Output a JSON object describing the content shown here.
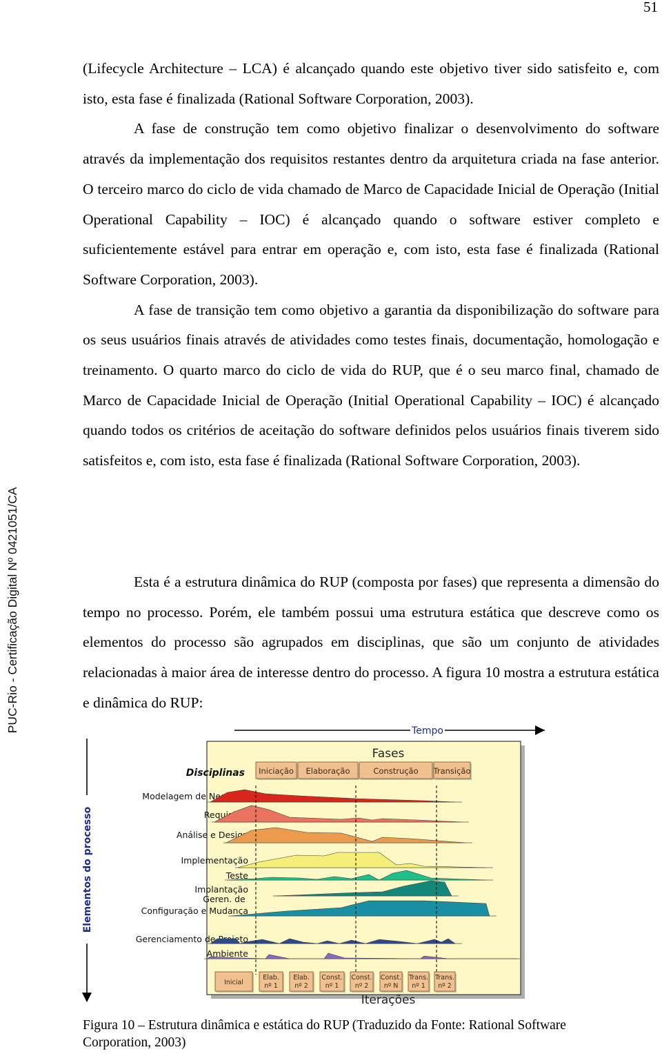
{
  "page": {
    "number": "51",
    "side_stamp": "PUC-Rio - Certificação Digital Nº 0421051/CA"
  },
  "paragraphs": [
    "(Lifecycle Architecture – LCA) é alcançado quando este objetivo tiver sido satisfeito e, com isto, esta fase é finalizada (Rational Software Corporation, 2003).",
    "A fase de construção tem como objetivo finalizar o desenvolvimento do software através da implementação dos requisitos restantes dentro da arquitetura criada na fase anterior. O terceiro marco do ciclo de vida chamado de Marco de Capacidade Inicial de Operação (Initial Operational Capability – IOC) é alcançado quando o software estiver completo e suficientemente estável para entrar em operação e, com isto, esta fase é finalizada (Rational Software Corporation, 2003).",
    "A fase de transição tem como objetivo a garantia da disponibilização do software para os seus usuários finais através de atividades como testes finais, documentação, homologação e treinamento. O quarto marco do ciclo de vida do RUP, que é o seu marco final, chamado de Marco de Capacidade Inicial de Operação (Initial Operational Capability – IOC) é alcançado quando todos os critérios de aceitação do software definidos pelos usuários finais tiverem sido satisfeitos e, com isto, esta fase é finalizada (Rational Software Corporation, 2003).",
    "Esta é a estrutura dinâmica do RUP (composta por fases) que representa a dimensão do tempo no processo. Porém, ele também possui uma estrutura estática que descreve como os elementos do processo são agrupados em disciplinas, que são um conjunto de atividades relacionadas à maior área de interesse dentro do processo. A figura 10 mostra a estrutura estática e dinâmica do RUP:"
  ],
  "figure": {
    "time_label": "Tempo",
    "process_axis_label": "Elementos do processo",
    "phases_title": "Fases",
    "disciplines_title": "Disciplinas",
    "iterations_title": "Iterações",
    "phases": [
      "Iniciação",
      "Elaboração",
      "Construção",
      "Transição"
    ],
    "disciplines": [
      {
        "label": "Modelagem de Negócios",
        "color": "#d9261c"
      },
      {
        "label": "Requisitos",
        "color": "#e8735f"
      },
      {
        "label": "Análise e Design",
        "color": "#ec9a4c"
      },
      {
        "label": "Implementação",
        "color": "#f5ef7a"
      },
      {
        "label": "Teste",
        "color": "#1fbf8a"
      },
      {
        "label": "Implantação",
        "color": "#13877a"
      },
      {
        "label": "Geren. de Configuração e Mudança",
        "label_lines": [
          "Geren. de",
          "Configuração e Mudança"
        ],
        "color": "#1a8ea2"
      },
      {
        "label": "Gerenciamento de Projeto",
        "color": "#2c4a8c"
      },
      {
        "label": "Ambiente",
        "color": "#8a6bc0"
      }
    ],
    "iterations": [
      [
        "Inicial"
      ],
      [
        "Elab.",
        "nº 1"
      ],
      [
        "Elab.",
        "nº 2"
      ],
      [
        "Const.",
        "nº 1"
      ],
      [
        "Const.",
        "nº 2"
      ],
      [
        "Const.",
        "nº N"
      ],
      [
        "Trans.",
        "nº 1"
      ],
      [
        "Trans.",
        "nº 2"
      ]
    ],
    "colors": {
      "panel_bg": "#fdf8c6",
      "box_fill": "#f0c08e",
      "title_text": "#1d2d8c"
    }
  },
  "caption": "Figura 10 – Estrutura dinâmica e estática do RUP  (Traduzido da Fonte: Rational Software Corporation, 2003)"
}
